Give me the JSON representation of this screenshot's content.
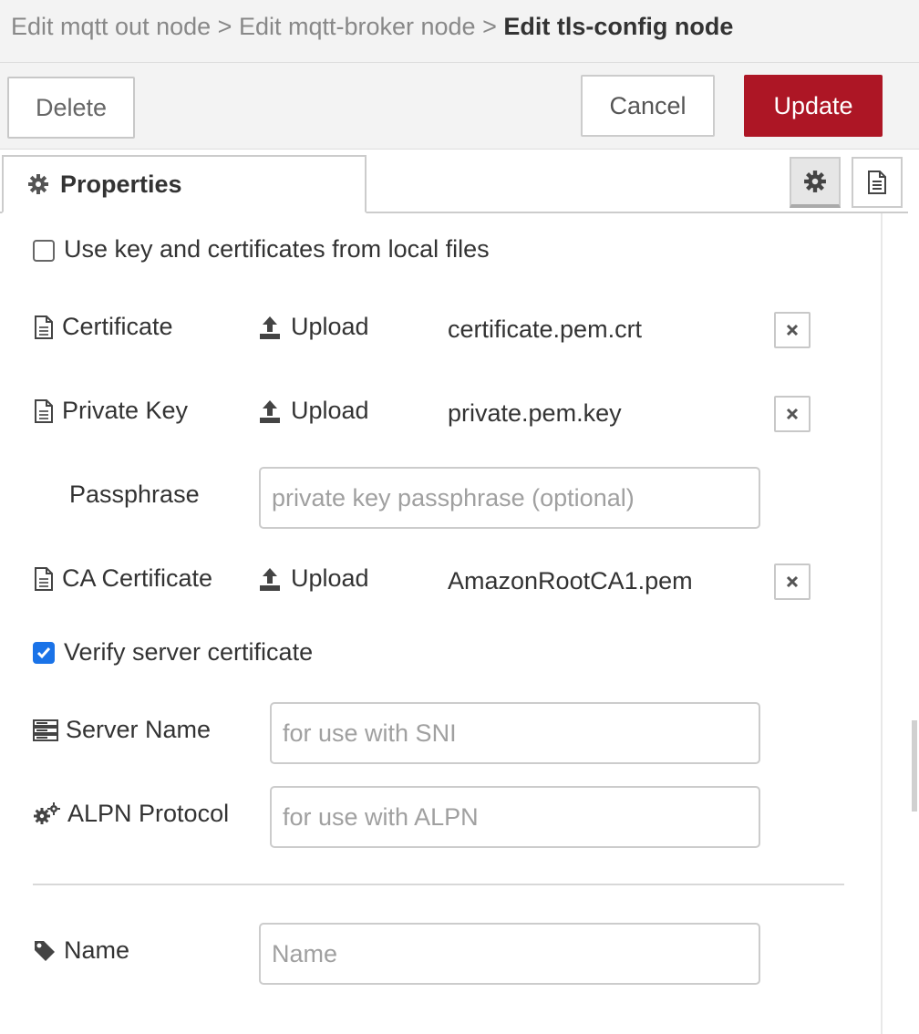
{
  "breadcrumb": {
    "item1": "Edit mqtt out node",
    "separator": ">",
    "item2": "Edit mqtt-broker node",
    "current": "Edit tls-config node"
  },
  "toolbar": {
    "delete_label": "Delete",
    "cancel_label": "Cancel",
    "update_label": "Update"
  },
  "colors": {
    "update_button": "#ad1625",
    "checkbox_checked": "#1a73e8"
  },
  "tabs": {
    "properties_label": "Properties",
    "properties_icon": "gear-icon",
    "settings_icon": "gear-icon",
    "info_icon": "document-icon"
  },
  "form": {
    "use_local_files": {
      "label": "Use key and certificates from local files",
      "checked": false
    },
    "certificate": {
      "label": "Certificate",
      "upload_label": "Upload",
      "file": "certificate.pem.crt",
      "icon": "file-icon"
    },
    "private_key": {
      "label": "Private Key",
      "upload_label": "Upload",
      "file": "private.pem.key",
      "icon": "file-icon"
    },
    "passphrase": {
      "label": "Passphrase",
      "placeholder": "private key passphrase (optional)",
      "value": ""
    },
    "ca_certificate": {
      "label": "CA Certificate",
      "upload_label": "Upload",
      "file": "AmazonRootCA1.pem",
      "icon": "file-icon"
    },
    "verify_server": {
      "label": "Verify server certificate",
      "checked": true
    },
    "server_name": {
      "label": "Server Name",
      "placeholder": "for use with SNI",
      "value": "",
      "icon": "server-icon"
    },
    "alpn_protocol": {
      "label": "ALPN Protocol",
      "placeholder": "for use with ALPN",
      "value": "",
      "icon": "cogs-icon"
    },
    "name": {
      "label": "Name",
      "placeholder": "Name",
      "value": "",
      "icon": "tag-icon"
    }
  }
}
